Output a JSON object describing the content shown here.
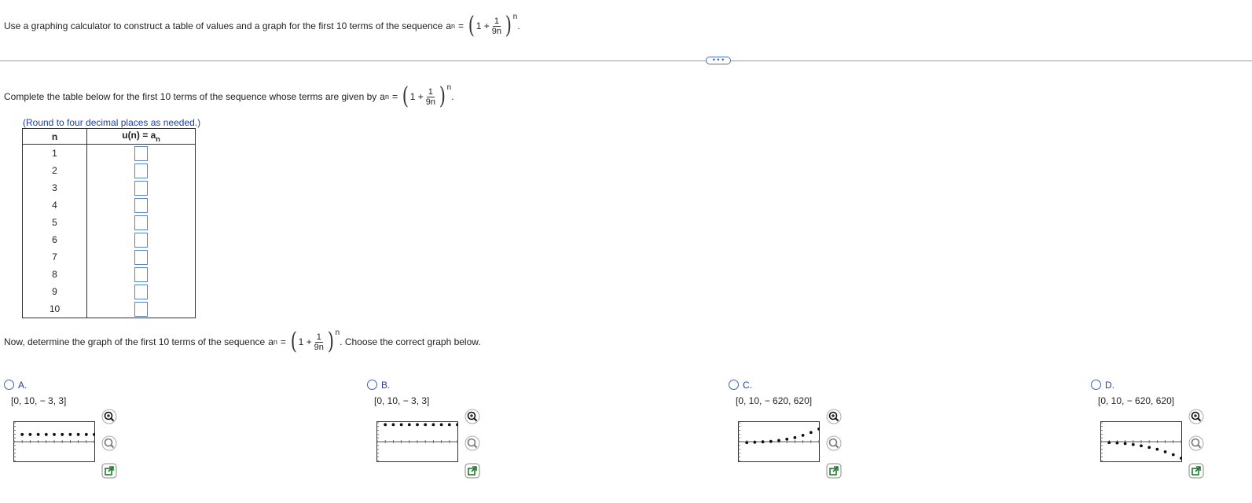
{
  "question": {
    "prompt_text": "Use a graphing calculator to construct a table of values and a graph for the first 10 terms of the sequence",
    "seq_lhs": "a",
    "seq_sub": "n",
    "seq_eq": "=",
    "one_plus": "1 +",
    "frac_num": "1",
    "frac_den": "9n",
    "exponent": "n",
    "period": "."
  },
  "more_button": "• • •",
  "table_section": {
    "instruction": "Complete the table below for the first 10 terms of the sequence whose terms are given by",
    "rounding_hint": "(Round to four decimal places as needed.)",
    "header_n": "n",
    "header_u": "u(n) = a",
    "header_u_sub": "n",
    "n_values": [
      "1",
      "2",
      "3",
      "4",
      "5",
      "6",
      "7",
      "8",
      "9",
      "10"
    ]
  },
  "graph_section": {
    "instruction": "Now, determine the graph of the first 10 terms of the sequence",
    "suffix": ". Choose the correct graph below."
  },
  "options": [
    {
      "letter": "A.",
      "window": "[0, 10, − 3, 3]",
      "trend": "flat-low",
      "values": [
        1.1,
        1.1,
        1.1,
        1.1,
        1.1,
        1.1,
        1.1,
        1.1,
        1.1,
        1.1
      ],
      "ylim": [
        -3,
        3
      ]
    },
    {
      "letter": "B.",
      "window": "[0, 10, − 3, 3]",
      "trend": "flat-high",
      "values": [
        2.6,
        2.6,
        2.6,
        2.6,
        2.6,
        2.6,
        2.6,
        2.6,
        2.6,
        2.6
      ],
      "ylim": [
        -3,
        3
      ]
    },
    {
      "letter": "C.",
      "window": "[0, 10, − 620, 620]",
      "trend": "increasing",
      "values": [
        -30,
        -20,
        -5,
        10,
        40,
        80,
        130,
        200,
        290,
        400
      ],
      "ylim": [
        -620,
        620
      ]
    },
    {
      "letter": "D.",
      "window": "[0, 10, − 620, 620]",
      "trend": "decreasing",
      "values": [
        -30,
        -40,
        -60,
        -90,
        -130,
        -180,
        -240,
        -320,
        -410,
        -520
      ],
      "ylim": [
        -620,
        620
      ]
    }
  ],
  "icons": {
    "zoom_in": "zoom-in-icon",
    "zoom_out": "zoom-out-icon",
    "popout": "popout-icon"
  },
  "colors": {
    "link_blue": "#1f3fa5",
    "box_border": "#5a84c8",
    "icon_green": "#1f7a2e"
  }
}
